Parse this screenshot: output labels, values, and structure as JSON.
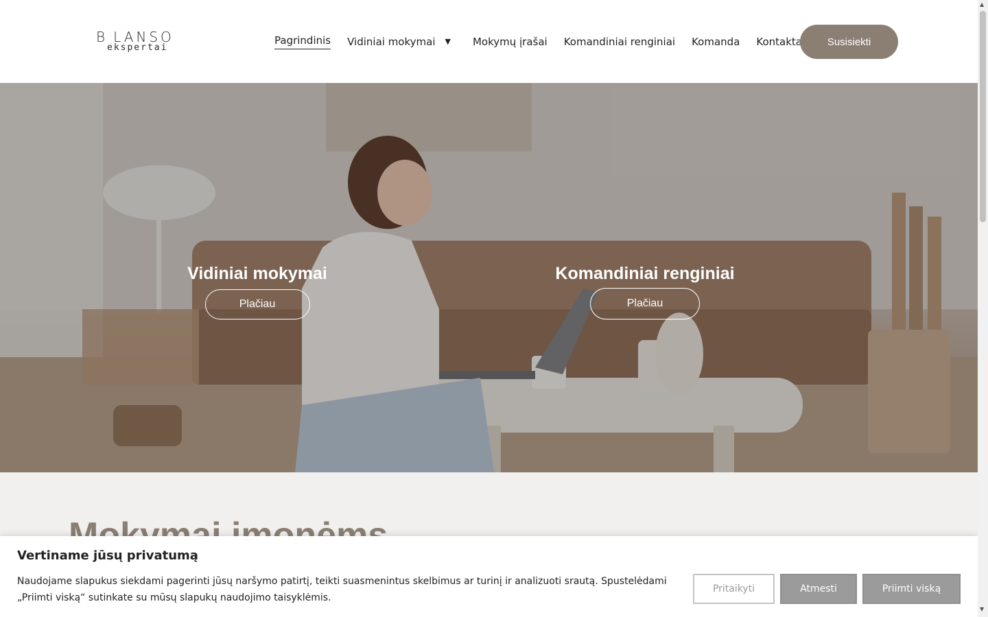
{
  "header": {
    "logo_top": "B LANSO",
    "logo_bottom": "ekspertai",
    "nav": [
      {
        "label": "Pagrindinis"
      },
      {
        "label": "Vidiniai mokymai"
      },
      {
        "label": "Mokymų įrašai"
      },
      {
        "label": "Komandiniai renginiai"
      },
      {
        "label": "Komanda"
      },
      {
        "label": "Kontaktai"
      }
    ],
    "caret": "▼",
    "cta_label": "Susisiekti"
  },
  "hero": {
    "left": {
      "title": "Vidiniai mokymai",
      "button": "Plačiau"
    },
    "right": {
      "title": "Komandiniai renginiai",
      "button": "Plačiau"
    }
  },
  "section": {
    "title": "Mokymai įmonėms"
  },
  "cookie": {
    "title": "Vertiname jūsų privatumą",
    "text": "Naudojame slapukus siekdami pagerinti jūsų naršymo patirtį, teikti suasmenintus skelbimus ar turinį ir analizuoti srautą. Spustelėdami „Priimti viską“ sutinkate su mūsų slapukų naudojimo taisyklėmis.",
    "customize": "Pritaikyti",
    "reject": "Atmesti",
    "accept": "Priimti viską"
  },
  "colors": {
    "brand": "#8b7f74",
    "cookie_button": "#9b9b9b"
  }
}
